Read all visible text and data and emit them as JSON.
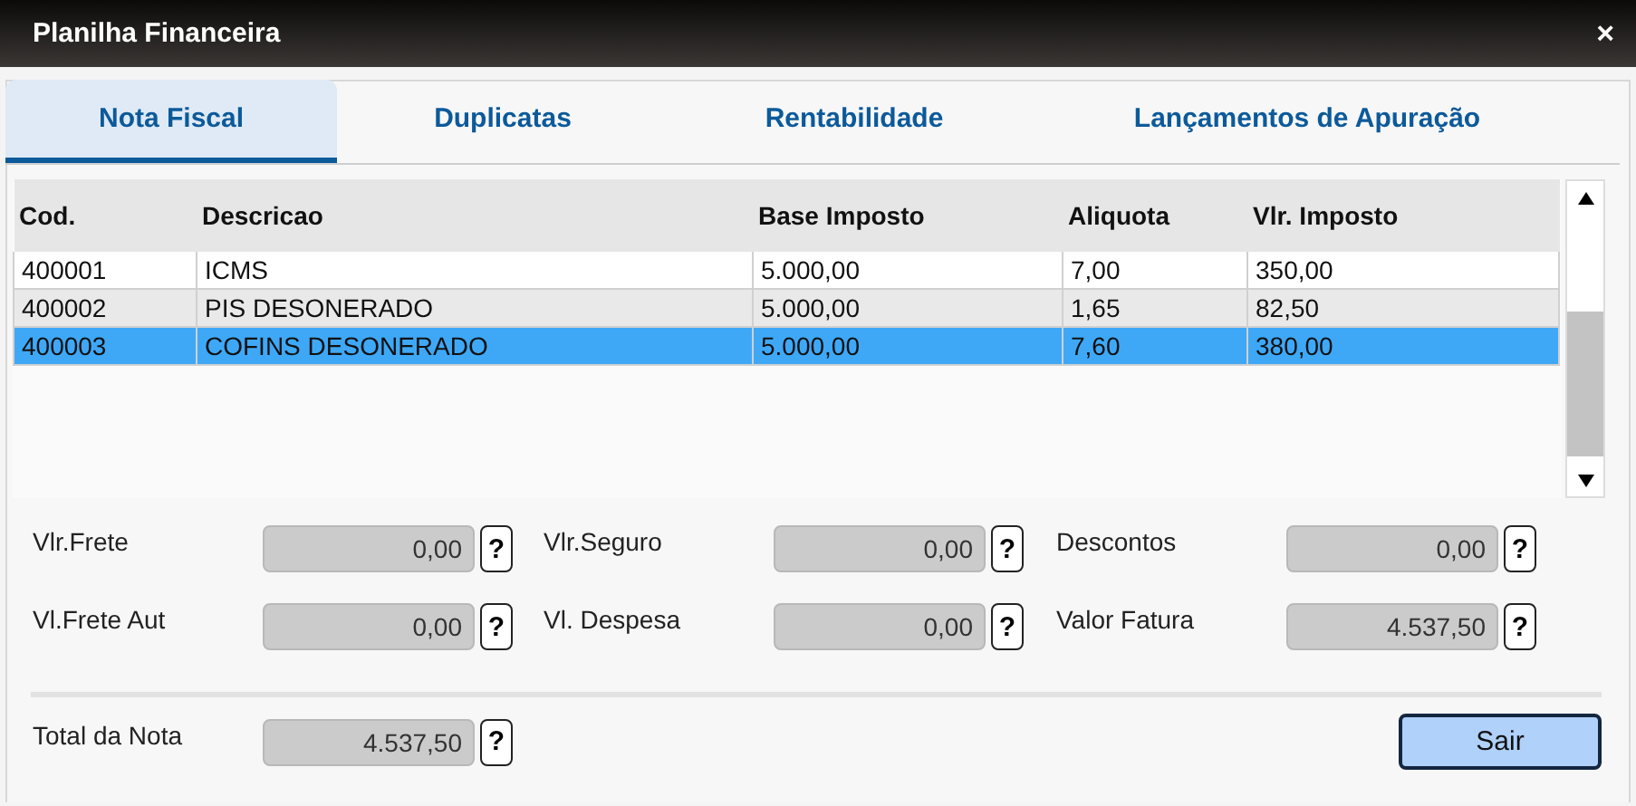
{
  "window": {
    "title": "Planilha Financeira",
    "close": "×"
  },
  "tabs": [
    {
      "label": "Nota Fiscal",
      "selected": true
    },
    {
      "label": "Duplicatas",
      "selected": false
    },
    {
      "label": "Rentabilidade",
      "selected": false
    },
    {
      "label": "Lançamentos de Apuração",
      "selected": false
    }
  ],
  "table": {
    "columns": [
      "Cod.",
      "Descricao",
      "Base Imposto",
      "Aliquota",
      "Vlr. Imposto"
    ],
    "rows": [
      {
        "cells": [
          "400001",
          "ICMS",
          "5.000,00",
          "7,00",
          "350,00"
        ],
        "selected": false
      },
      {
        "cells": [
          "400002",
          "PIS DESONERADO",
          "5.000,00",
          "1,65",
          "82,50"
        ],
        "selected": false
      },
      {
        "cells": [
          "400003",
          "COFINS DESONERADO",
          "5.000,00",
          "7,60",
          "380,00"
        ],
        "selected": true
      }
    ]
  },
  "fields": [
    {
      "label": "Vlr.Frete",
      "value": "0,00",
      "help": "?"
    },
    {
      "label": "Vlr.Seguro",
      "value": "0,00",
      "help": "?"
    },
    {
      "label": "Descontos",
      "value": "0,00",
      "help": "?"
    },
    {
      "label": "Vl.Frete Aut",
      "value": "0,00",
      "help": "?"
    },
    {
      "label": "Vl. Despesa",
      "value": "0,00",
      "help": "?"
    },
    {
      "label": "Valor Fatura",
      "value": "4.537,50",
      "help": "?"
    }
  ],
  "total": {
    "label": "Total da Nota",
    "value": "4.537,50",
    "help": "?"
  },
  "buttons": [
    "Sair"
  ]
}
